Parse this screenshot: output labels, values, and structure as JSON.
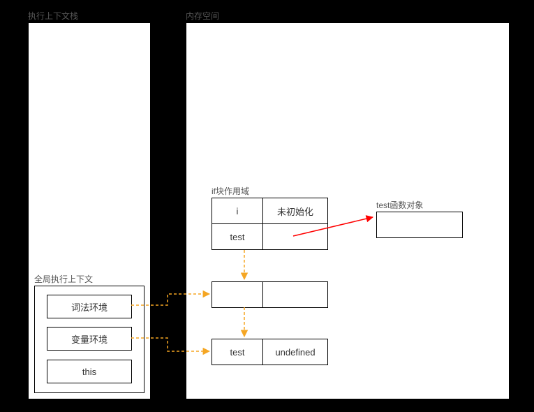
{
  "labels": {
    "stack_title": "执行上下文栈",
    "memory_title": "内存空间",
    "global_ctx": "全局执行上下文",
    "lexical_env": "词法环境",
    "variable_env": "变量环境",
    "this_binding": "this",
    "if_scope": "if块作用域",
    "func_obj": "test函数对象"
  },
  "table_upper": {
    "r1c1": "i",
    "r1c2": "未初始化",
    "r2c1": "test",
    "r2c2": ""
  },
  "table_middle": {
    "r1c1": "",
    "r1c2": ""
  },
  "table_lower": {
    "r1c1": "test",
    "r1c2": "undefined"
  }
}
